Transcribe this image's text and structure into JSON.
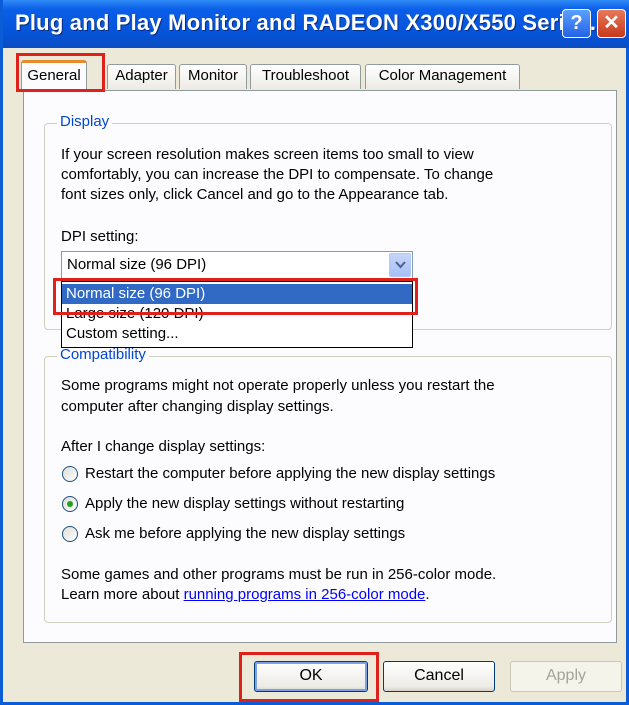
{
  "window": {
    "title": "Plug and Play Monitor and RADEON X300/X550 Serie..."
  },
  "titlebar_buttons": {
    "help": "?",
    "close": "✕"
  },
  "tabs": [
    {
      "label": "General"
    },
    {
      "label": "Adapter"
    },
    {
      "label": "Monitor"
    },
    {
      "label": "Troubleshoot"
    },
    {
      "label": "Color Management"
    }
  ],
  "display_group": {
    "legend": "Display",
    "description_lines": [
      "If your screen resolution makes screen items too small to view",
      "comfortably, you can increase the DPI to compensate.  To change",
      "font sizes only, click Cancel and go to the Appearance tab."
    ],
    "dpi_label": "DPI setting:",
    "dpi_selected": "Normal size (96 DPI)",
    "dpi_options": [
      "Normal size (96 DPI)",
      "Large size (120 DPI)",
      "Custom setting..."
    ]
  },
  "compat_group": {
    "legend": "Compatibility",
    "description_lines": [
      "Some programs might not operate properly unless you restart the",
      "computer after changing display settings."
    ],
    "after_label": "After I change display settings:",
    "radios": [
      {
        "label": "Restart the computer before applying the new display settings",
        "checked": false
      },
      {
        "label": "Apply the new display settings without restarting",
        "checked": true
      },
      {
        "label": "Ask me before applying the new display settings",
        "checked": false
      }
    ],
    "note_line1": "Some games and other programs must be run in 256-color mode.",
    "note_prefix": "Learn more about ",
    "note_link": "running programs in 256-color mode",
    "note_suffix": "."
  },
  "buttons": {
    "ok": "OK",
    "cancel": "Cancel",
    "apply": "Apply"
  },
  "colors": {
    "highlight": "#e0201a",
    "selection": "#316ac5",
    "titlebar": "#0554d8"
  }
}
